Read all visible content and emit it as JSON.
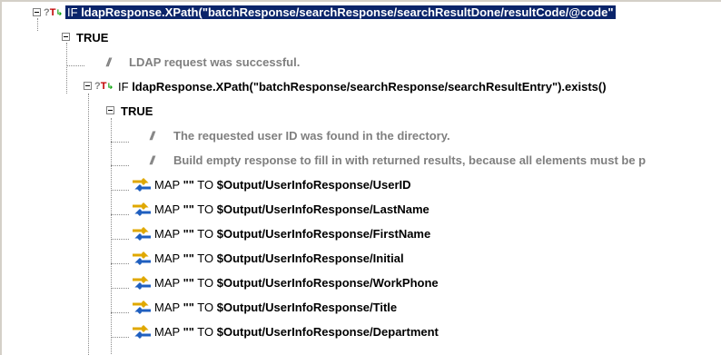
{
  "tree": {
    "if_root": {
      "keyword": "IF",
      "expression": "ldapResponse.XPath(\"batchResponse/searchResponse/searchResultDone/resultCode/@code\""
    },
    "true_1": "TRUE",
    "comment_1": "LDAP request was successful.",
    "if_nested": {
      "keyword": "IF",
      "expression": "ldapResponse.XPath(\"batchResponse/searchResponse/searchResultEntry\").exists()"
    },
    "true_2": "TRUE",
    "comment_2": "The requested user ID was found in the directory.",
    "comment_3": "Build empty response to fill in with returned results, because all elements must be p",
    "comment_marker": "//",
    "maps": [
      {
        "keyword": "MAP",
        "value": "\"\"",
        "to": "TO",
        "target": "$Output/UserInfoResponse/UserID"
      },
      {
        "keyword": "MAP",
        "value": "\"\"",
        "to": "TO",
        "target": "$Output/UserInfoResponse/LastName"
      },
      {
        "keyword": "MAP",
        "value": "\"\"",
        "to": "TO",
        "target": "$Output/UserInfoResponse/FirstName"
      },
      {
        "keyword": "MAP",
        "value": "\"\"",
        "to": "TO",
        "target": "$Output/UserInfoResponse/Initial"
      },
      {
        "keyword": "MAP",
        "value": "\"\"",
        "to": "TO",
        "target": "$Output/UserInfoResponse/WorkPhone"
      },
      {
        "keyword": "MAP",
        "value": "\"\"",
        "to": "TO",
        "target": "$Output/UserInfoResponse/Title"
      },
      {
        "keyword": "MAP",
        "value": "\"\"",
        "to": "TO",
        "target": "$Output/UserInfoResponse/Department"
      }
    ],
    "if_icon": {
      "q": "?",
      "t": "T",
      "arrow": "↳"
    },
    "colors": {
      "selection": "#0a246a",
      "comment": "#7f7f7f",
      "map_icon_blue": "#1f5fbf",
      "map_icon_gold": "#e0a800"
    }
  }
}
